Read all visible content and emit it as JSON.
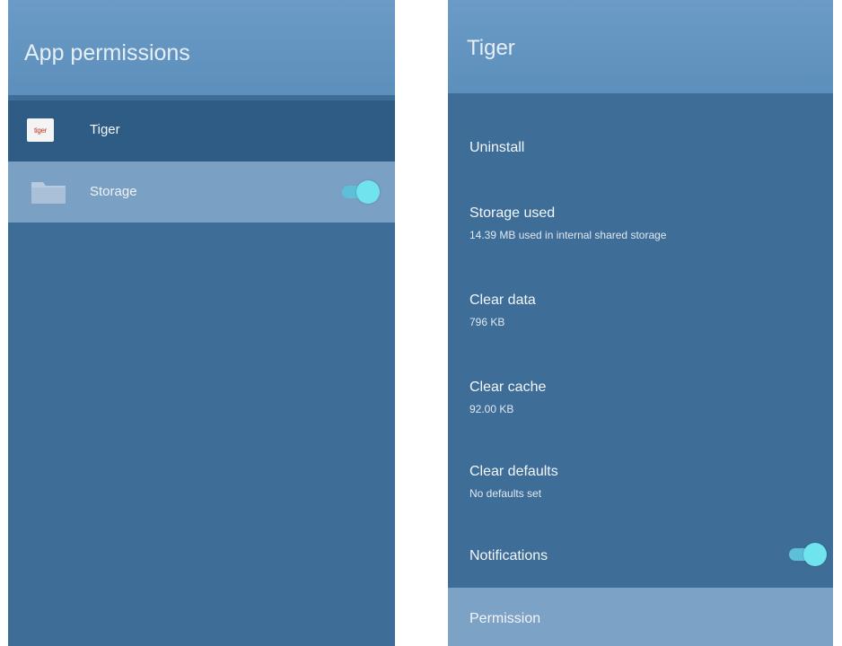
{
  "left_panel": {
    "title": "App permissions",
    "app_row": {
      "label": "Tiger",
      "icon_text": "tiger"
    },
    "storage_row": {
      "label": "Storage",
      "toggle_on": true
    }
  },
  "right_panel": {
    "title": "Tiger",
    "items": [
      {
        "label": "Uninstall"
      },
      {
        "label": "Storage used",
        "sub": "14.39 MB used in internal shared storage"
      },
      {
        "label": "Clear data",
        "sub": "796 KB"
      },
      {
        "label": "Clear cache",
        "sub": "92.00 KB"
      },
      {
        "label": "Clear defaults",
        "sub": "No defaults set"
      },
      {
        "label": "Notifications",
        "toggle_on": true
      }
    ],
    "permission_row": {
      "label": "Permission"
    }
  },
  "colors": {
    "panel_bg": "#3e6e98",
    "header_bg": "#6b9bc6",
    "selected_row_bg": "#7aa0c4",
    "toggle_accent": "#6fe3ee"
  },
  "icons": {
    "app_icon": "tiger-app-icon",
    "storage_icon": "folder-icon"
  }
}
